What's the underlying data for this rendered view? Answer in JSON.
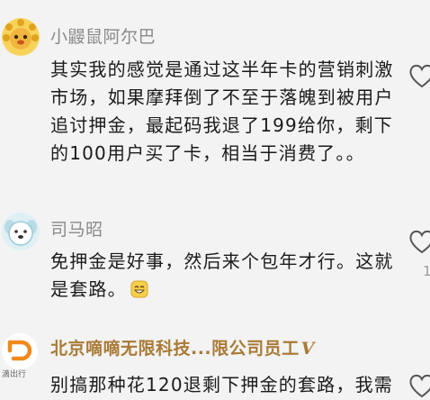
{
  "comments": [
    {
      "username": "小鼹鼠阿尔巴",
      "lines": [
        "其实我的感觉是通过这半年卡的营销刺激",
        "市场，如果摩拜倒了不至于落魄到被用户",
        "追讨押金，最起码我退了199给你，剩下",
        "的100用户买了卡，相当于消费了。。"
      ],
      "avatar": "mole-avatar-icon",
      "like_icon": "heart-outline-icon"
    },
    {
      "username": "司马昭",
      "lines": [
        "免押金是好事，然后来个包年才行。这就",
        "是套路。"
      ],
      "emoji": "grinning-emoji-icon",
      "avatar": "dog-avatar-icon",
      "like_icon": "heart-outline-icon",
      "like_count": "1"
    },
    {
      "username": "北京嘀嘀无限科技...限公司员工",
      "badge": "V",
      "avatar_caption": "滴出行",
      "lines": [
        "别搞那种花120退剩下押金的套路，我需"
      ],
      "avatar": "didi-logo-avatar-icon",
      "like_icon": "heart-outline-icon"
    }
  ],
  "colors": {
    "background": "#f3f3f3",
    "username": "#8a8a8a",
    "official_username": "#a97a36",
    "text": "#1b1b1b",
    "didi_orange": "#f08a1d"
  }
}
